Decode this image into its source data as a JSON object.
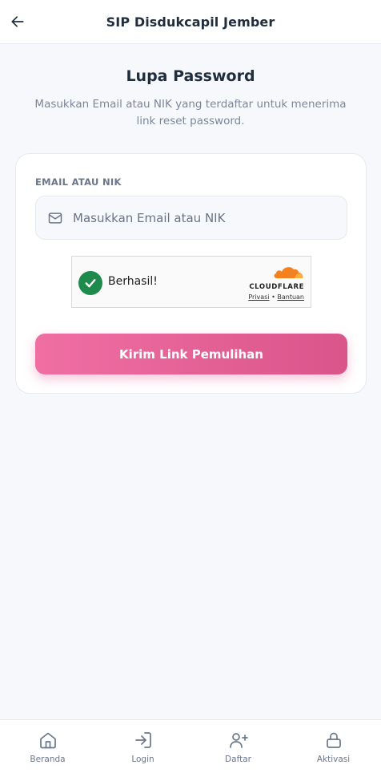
{
  "header": {
    "title": "SIP Disdukcapil Jember",
    "back_icon": "arrow-left-icon"
  },
  "page": {
    "title": "Lupa Password",
    "subtitle": "Masukkan Email atau NIK yang terdaftar untuk menerima link reset password."
  },
  "form": {
    "field_label": "EMAIL ATAU NIK",
    "input_value": "",
    "input_placeholder": "Masukkan Email atau NIK",
    "input_icon": "mail-icon",
    "submit_label": "Kirim Link Pemulihan"
  },
  "captcha": {
    "status_text": "Berhasil!",
    "provider": "CLOUDFLARE",
    "link_privacy": "Privasi",
    "separator": "•",
    "link_help": "Bantuan"
  },
  "bottom_nav": {
    "items": [
      {
        "label": "Beranda",
        "icon": "home-icon"
      },
      {
        "label": "Login",
        "icon": "login-icon"
      },
      {
        "label": "Daftar",
        "icon": "user-plus-icon"
      },
      {
        "label": "Aktivasi",
        "icon": "lock-icon"
      }
    ]
  },
  "colors": {
    "primary_gradient_start": "#f06fa3",
    "primary_gradient_end": "#d9558a",
    "success_green": "#1e8a4c",
    "cloudflare_orange": "#f48120",
    "text_dark": "#1f2d3d",
    "text_muted": "#7b8799",
    "background": "#f7f8fc"
  }
}
